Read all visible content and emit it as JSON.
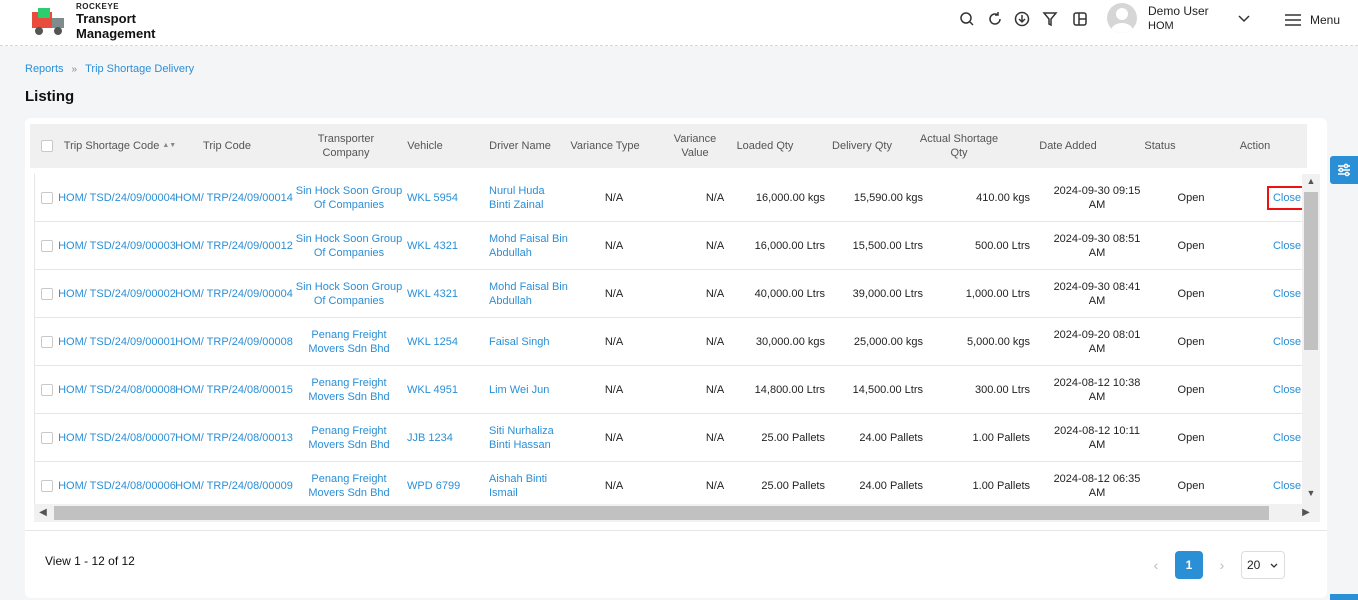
{
  "header": {
    "brand_small": "ROCKEYE",
    "brand_line1": "Transport",
    "brand_line2": "Management",
    "user_name": "Demo User",
    "user_org": "HOM",
    "menu_label": "Menu",
    "tools": [
      "search-icon",
      "refresh-icon",
      "download-icon",
      "filter-icon",
      "columns-icon"
    ]
  },
  "breadcrumb": {
    "item1": "Reports",
    "item2": "Trip Shortage Delivery"
  },
  "page": {
    "title": "Listing"
  },
  "columns": {
    "trip_shortage_code": "Trip Shortage Code",
    "trip_code": "Trip Code",
    "transporter_company": "Transporter Company",
    "vehicle": "Vehicle",
    "driver_name": "Driver Name",
    "variance_type": "Variance Type",
    "variance_value": "Variance Value",
    "loaded_qty": "Loaded Qty",
    "delivery_qty": "Delivery Qty",
    "actual_shortage_qty": "Actual Shortage Qty",
    "date_added": "Date Added",
    "status": "Status",
    "action": "Action"
  },
  "rows": [
    {
      "code": "HOM/ TSD/24/09/00004",
      "trip": "HOM/ TRP/24/09/00014",
      "company": "Sin Hock Soon Group Of Companies",
      "vehicle": "WKL 5954",
      "driver": "Nurul Huda Binti Zainal",
      "vtype": "N/A",
      "vvalue": "N/A",
      "loaded": "16,000.00 kgs",
      "delivery": "15,590.00 kgs",
      "shortage": "410.00 kgs",
      "date": "2024-09-30 09:15 AM",
      "status": "Open",
      "action": "Close"
    },
    {
      "code": "HOM/ TSD/24/09/00003",
      "trip": "HOM/ TRP/24/09/00012",
      "company": "Sin Hock Soon Group Of Companies",
      "vehicle": "WKL 4321",
      "driver": "Mohd Faisal Bin Abdullah",
      "vtype": "N/A",
      "vvalue": "N/A",
      "loaded": "16,000.00 Ltrs",
      "delivery": "15,500.00 Ltrs",
      "shortage": "500.00 Ltrs",
      "date": "2024-09-30 08:51 AM",
      "status": "Open",
      "action": "Close"
    },
    {
      "code": "HOM/ TSD/24/09/00002",
      "trip": "HOM/ TRP/24/09/00004",
      "company": "Sin Hock Soon Group Of Companies",
      "vehicle": "WKL 4321",
      "driver": "Mohd Faisal Bin Abdullah",
      "vtype": "N/A",
      "vvalue": "N/A",
      "loaded": "40,000.00 Ltrs",
      "delivery": "39,000.00 Ltrs",
      "shortage": "1,000.00 Ltrs",
      "date": "2024-09-30 08:41 AM",
      "status": "Open",
      "action": "Close"
    },
    {
      "code": "HOM/ TSD/24/09/00001",
      "trip": "HOM/ TRP/24/09/00008",
      "company": "Penang Freight Movers Sdn Bhd",
      "vehicle": "WKL 1254",
      "driver": "Faisal Singh",
      "vtype": "N/A",
      "vvalue": "N/A",
      "loaded": "30,000.00 kgs",
      "delivery": "25,000.00 kgs",
      "shortage": "5,000.00 kgs",
      "date": "2024-09-20 08:01 AM",
      "status": "Open",
      "action": "Close"
    },
    {
      "code": "HOM/ TSD/24/08/00008",
      "trip": "HOM/ TRP/24/08/00015",
      "company": "Penang Freight Movers Sdn Bhd",
      "vehicle": "WKL 4951",
      "driver": "Lim Wei Jun",
      "vtype": "N/A",
      "vvalue": "N/A",
      "loaded": "14,800.00 Ltrs",
      "delivery": "14,500.00 Ltrs",
      "shortage": "300.00 Ltrs",
      "date": "2024-08-12 10:38 AM",
      "status": "Open",
      "action": "Close"
    },
    {
      "code": "HOM/ TSD/24/08/00007",
      "trip": "HOM/ TRP/24/08/00013",
      "company": "Penang Freight Movers Sdn Bhd",
      "vehicle": "JJB 1234",
      "driver": "Siti Nurhaliza Binti Hassan",
      "vtype": "N/A",
      "vvalue": "N/A",
      "loaded": "25.00 Pallets",
      "delivery": "24.00 Pallets",
      "shortage": "1.00 Pallets",
      "date": "2024-08-12 10:11 AM",
      "status": "Open",
      "action": "Close"
    },
    {
      "code": "HOM/ TSD/24/08/00006",
      "trip": "HOM/ TRP/24/08/00009",
      "company": "Penang Freight Movers Sdn Bhd",
      "vehicle": "WPD 6799",
      "driver": "Aishah Binti Ismail",
      "vtype": "N/A",
      "vvalue": "N/A",
      "loaded": "25.00 Pallets",
      "delivery": "24.00 Pallets",
      "shortage": "1.00 Pallets",
      "date": "2024-08-12 06:35 AM",
      "status": "Open",
      "action": "Close"
    }
  ],
  "footer": {
    "view_count": "View 1 - 12 of 12",
    "current_page": "1",
    "page_size": "20"
  },
  "colors": {
    "accent": "#2b8fd6",
    "highlight": "#e11111"
  }
}
